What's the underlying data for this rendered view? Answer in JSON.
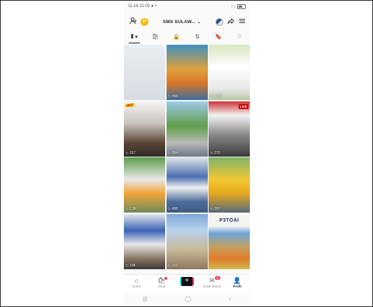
{
  "status_bar": {
    "time": "11.16 21:02 ● •",
    "signal": "⁝ ‹"
  },
  "header": {
    "account_name": "SMS SULAW... ⌄",
    "coin_label": "P",
    "icons": [
      "add-friend-icon",
      "coin-icon",
      "avatar-icon",
      "share-icon",
      "menu-icon"
    ]
  },
  "tabs": [
    {
      "label": "⦀ ▾",
      "icon": "videos-grid-icon",
      "active": true
    },
    {
      "label": "🛍",
      "icon": "shop-icon",
      "active": false
    },
    {
      "label": "🔒",
      "icon": "private-lock-icon",
      "active": false
    },
    {
      "label": "⇅",
      "icon": "repost-icon",
      "active": false
    },
    {
      "label": "🔖",
      "icon": "bookmark-icon",
      "active": false
    },
    {
      "label": "♡",
      "icon": "liked-heart-icon",
      "active": false
    }
  ],
  "videos": [
    {
      "views": "",
      "bg": "linear-gradient(180deg,#e9eef3 0%,#d7dce2 100%)",
      "badge": "",
      "badge_red": "",
      "title": ""
    },
    {
      "views": "▷ 458",
      "bg": "linear-gradient(180deg,#3f8fbf 0%,#e0a13a 45%,#d6742a 70%,#3a6f9e 100%)",
      "badge": "",
      "badge_red": "",
      "title": ""
    },
    {
      "views": "▷ 1.5K",
      "bg": "linear-gradient(180deg,#d8e6c0 0%,#ffffff 40%,#e8e8e8 80%,#b8c7a2 100%)",
      "badge": "",
      "badge_red": "",
      "title": ""
    },
    {
      "views": "▷ 317",
      "bg": "linear-gradient(180deg,#f4f4f4 0%,#c9c4bc 40%,#5a4636 75%,#2d2a28 100%)",
      "badge": "HUT",
      "badge_red": "",
      "title": ""
    },
    {
      "views": "▷ 264",
      "bg": "linear-gradient(180deg,#9fc9e8 0%,#5f9e4a 45%,#b8b8b8 75%,#6c7a86 100%)",
      "badge": "",
      "badge_red": "",
      "title": ""
    },
    {
      "views": "▷ 272",
      "bg": "linear-gradient(180deg,#c33 0%,#f3f3f3 25%,#8a8a8a 60%,#3b3b3b 100%)",
      "badge": "",
      "badge_red": "LIVE",
      "title": ""
    },
    {
      "views": "▷ 1.9K",
      "bg": "linear-gradient(180deg,#5c9c4c 0%,#e9e9e9 40%,#f2a33a 65%,#6f8d5a 100%)",
      "badge": "",
      "badge_red": "",
      "title": ""
    },
    {
      "views": "▷ 458",
      "bg": "linear-gradient(180deg,#dfe3e8 0%,#4a6fb0 35%,#f0f0f0 55%,#4d6d9a 80%,#3c5c84 100%)",
      "badge": "",
      "badge_red": "",
      "title": ""
    },
    {
      "views": "▷ 297",
      "bg": "linear-gradient(180deg,#7fb36a 0%,#f2c832 40%,#e8a81e 65%,#556b7a 100%)",
      "badge": "",
      "badge_red": "",
      "title": ""
    },
    {
      "views": "▷ 194",
      "bg": "linear-gradient(180deg,#e3e7ee 0%,#3a64b4 30%,#e9e9e9 55%,#8b7a66 80%,#3f3a36 100%)",
      "badge": "",
      "badge_red": "",
      "title": ""
    },
    {
      "views": "▷ 215",
      "bg": "linear-gradient(180deg,#7fa8d8 0%,#b9d3ec 30%,#c9b79a 65%,#8d7a5e 100%)",
      "badge": "",
      "badge_red": "",
      "title": ""
    },
    {
      "views": "",
      "bg": "linear-gradient(180deg,#f4f4f0 0%,#f4f4f0 22%,#6aa4d6 35%,#c6a060 60%,#e07a2a 80%,#d2b84c 100%)",
      "badge": "",
      "badge_red": "",
      "title": "P3TOAI"
    }
  ],
  "bottom_nav": [
    {
      "label": "Home",
      "icon": "⌂",
      "icon_name": "home-icon",
      "active": false,
      "dot": false,
      "badge": ""
    },
    {
      "label": "Shop",
      "icon": "🛍",
      "icon_name": "shop-icon",
      "active": false,
      "dot": true,
      "badge": ""
    },
    {
      "label": "",
      "icon": "+",
      "icon_name": "create-plus-icon",
      "active": false,
      "dot": false,
      "badge": "",
      "plus": true
    },
    {
      "label": "Kotak Masuk",
      "icon": "✉",
      "icon_name": "inbox-icon",
      "active": false,
      "dot": false,
      "badge": "99"
    },
    {
      "label": "Profil",
      "icon": "👤",
      "icon_name": "profile-icon",
      "active": true,
      "dot": false,
      "badge": ""
    }
  ],
  "system_nav": [
    "|||",
    "◯",
    "‹"
  ]
}
